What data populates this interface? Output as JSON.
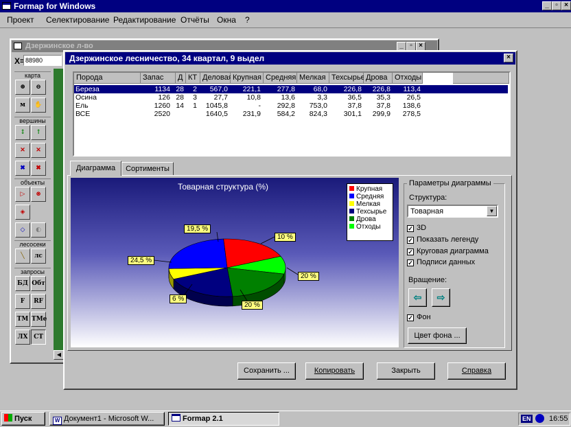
{
  "app": {
    "title": "Formap for Windows"
  },
  "menu": [
    "Проект",
    "Селектирование",
    "Редактирование",
    "Отчёты",
    "Окна",
    "?"
  ],
  "inner": {
    "title": "Дзержинское л-во",
    "x_label": "X=",
    "x_value": "88980",
    "groups": {
      "map": "карта",
      "vertices": "вершины",
      "objects": "объекты",
      "cuts": "лесосеки",
      "queries": "запросы"
    },
    "tools": {
      "m": "м",
      "ls": "лс",
      "bd": "БД",
      "obt": "Обт",
      "f": "F",
      "rf": "RF",
      "tm": "ТМ",
      "tme": "ТМе",
      "lh": "ЛХ",
      "st": "СТ"
    }
  },
  "dialog": {
    "title": "Дзержинское лесничество, 34 квартал, 9 выдел",
    "columns": [
      "Порода",
      "Запас",
      "Д",
      "КТ",
      "Деловая",
      "Крупная",
      "Средняя",
      "Мелкая",
      "Техсырье",
      "Дрова",
      "Отходы"
    ],
    "rows": [
      [
        "Береза",
        "1134",
        "28",
        "2",
        "567,0",
        "221,1",
        "277,8",
        "68,0",
        "226,8",
        "226,8",
        "113,4"
      ],
      [
        "Осина",
        "126",
        "28",
        "3",
        "27,7",
        "10,8",
        "13,6",
        "3,3",
        "36,5",
        "35,3",
        "26,5"
      ],
      [
        "Ель",
        "1260",
        "14",
        "1",
        "1045,8",
        "-",
        "292,8",
        "753,0",
        "37,8",
        "37,8",
        "138,6"
      ],
      [
        "ВСЕ",
        "2520",
        "",
        "",
        "1640,5",
        "231,9",
        "584,2",
        "824,3",
        "301,1",
        "299,9",
        "278,5"
      ]
    ],
    "tabs": [
      "Диаграмма",
      "Сортименты"
    ],
    "params": {
      "group_title": "Параметры диаграммы",
      "structure_label": "Структура:",
      "structure_value": "Товарная",
      "cb_3d": "3D",
      "cb_legend": "Показать легенду",
      "cb_pie": "Круговая диаграмма",
      "cb_labels": "Подписи данных",
      "rotation_label": "Вращение:",
      "cb_bg": "Фон",
      "bg_color_button": "Цвет фона ..."
    },
    "buttons": {
      "save": "Сохранить ...",
      "copy": "Копировать",
      "close": "Закрыть",
      "help": "Справка"
    }
  },
  "chart_data": {
    "type": "pie",
    "title": "Товарная структура (%)",
    "categories": [
      "Крупная",
      "Средняя",
      "Мелкая",
      "Техсырье",
      "Дрова",
      "Отходы"
    ],
    "values": [
      19.5,
      24.5,
      6,
      20,
      20,
      10
    ],
    "labels": [
      "19,5 %",
      "24,5 %",
      "6 %",
      "20 %",
      "20 %",
      "10 %"
    ],
    "colors": [
      "#ff0000",
      "#0000ff",
      "#ffff00",
      "#000080",
      "#008000",
      "#00ff00"
    ],
    "legend": "top-right",
    "3d": true,
    "background": "#1c1c80"
  },
  "taskbar": {
    "start": "Пуск",
    "tasks": [
      "Документ1 - Microsoft W...",
      "Formap 2.1"
    ],
    "lang": "EN",
    "time": "16:55"
  },
  "colors": {
    "title": "#000080",
    "face": "#c0c0c0",
    "selection": "#000080"
  }
}
